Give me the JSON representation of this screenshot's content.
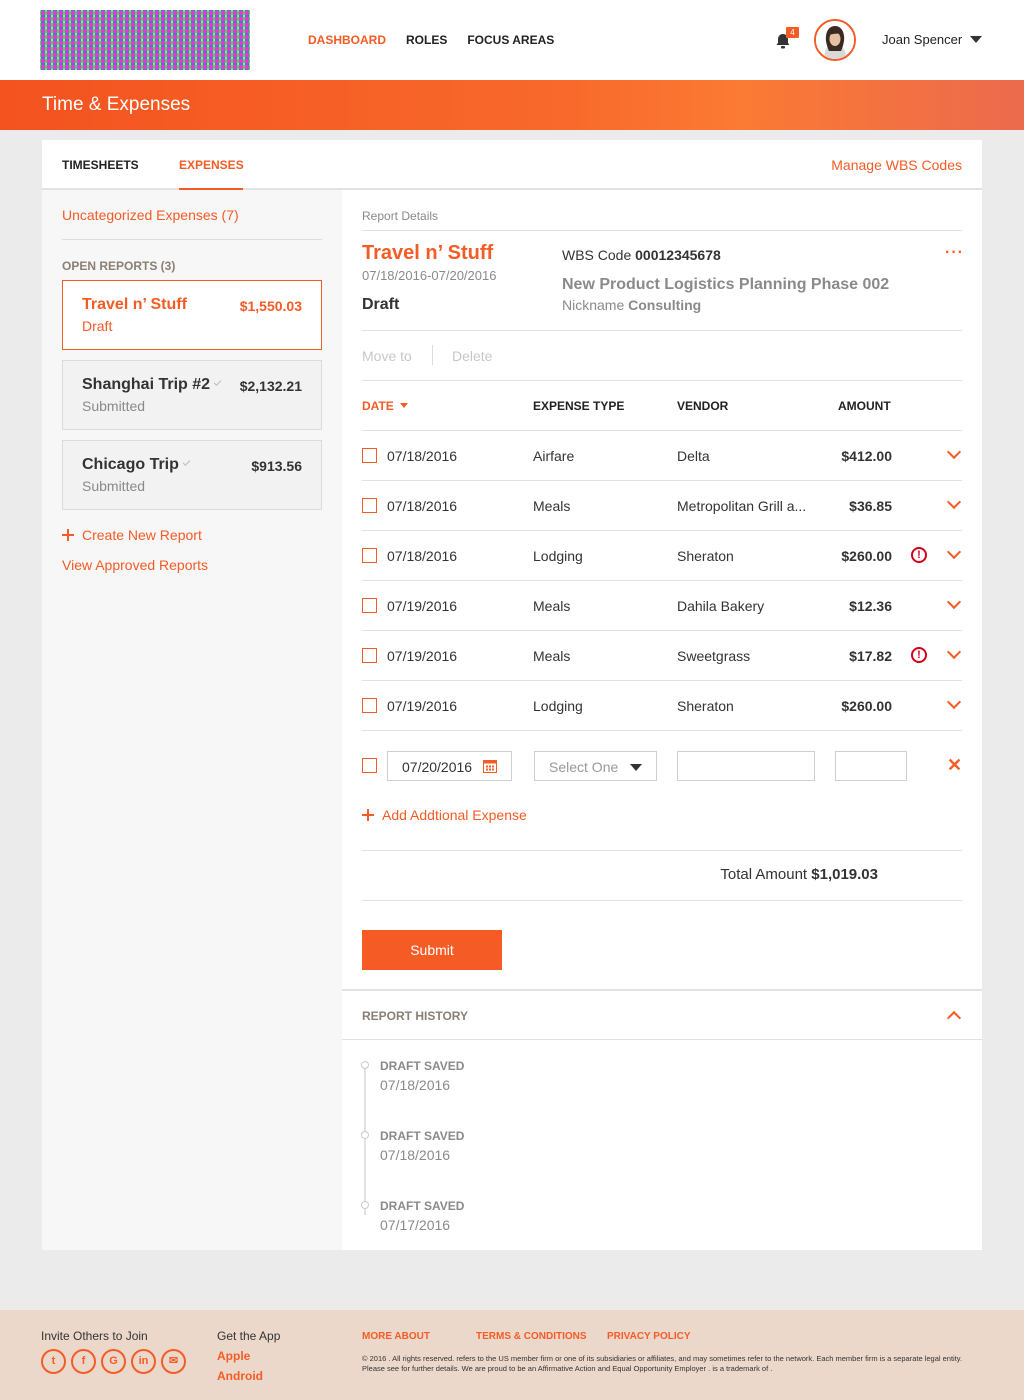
{
  "nav": {
    "items": [
      "DASHBOARD",
      "ROLES",
      "FOCUS AREAS"
    ],
    "active": 0
  },
  "user": {
    "notification_count": "4",
    "name": "Joan Spencer"
  },
  "banner": {
    "title": "Time & Expenses"
  },
  "tabs": {
    "timesheets": "TIMESHEETS",
    "expenses": "EXPENSES",
    "manage_link": "Manage WBS Codes"
  },
  "sidebar": {
    "uncategorized": "Uncategorized Expenses (7)",
    "open_reports_heading": "OPEN REPORTS (3)",
    "reports": [
      {
        "name": "Travel n’ Stuff",
        "amount": "$1,550.03",
        "status": "Draft"
      },
      {
        "name": "Shanghai Trip #2",
        "amount": "$2,132.21",
        "status": "Submitted"
      },
      {
        "name": "Chicago Trip",
        "amount": "$913.56",
        "status": "Submitted"
      }
    ],
    "create_report": "Create New Report",
    "view_approved": "View Approved Reports"
  },
  "report": {
    "section_label": "Report Details",
    "title": "Travel n’ Stuff",
    "date_range": "07/18/2016-07/20/2016",
    "status": "Draft",
    "wbs_label": "WBS Code",
    "wbs_code": "00012345678",
    "project": "New Product Logistics Planning Phase 002",
    "nickname_label": "Nickname",
    "nickname": "Consulting",
    "more": "···",
    "move_to": "Move to",
    "delete": "Delete"
  },
  "table": {
    "headers": {
      "date": "DATE",
      "type": "EXPENSE TYPE",
      "vendor": "VENDOR",
      "amount": "AMOUNT"
    },
    "rows": [
      {
        "date": "07/18/2016",
        "type": "Airfare",
        "vendor": "Delta",
        "amount": "$412.00",
        "warning": false
      },
      {
        "date": "07/18/2016",
        "type": "Meals",
        "vendor": "Metropolitan Grill a...",
        "amount": "$36.85",
        "warning": false
      },
      {
        "date": "07/18/2016",
        "type": "Lodging",
        "vendor": "Sheraton",
        "amount": "$260.00",
        "warning": true
      },
      {
        "date": "07/19/2016",
        "type": "Meals",
        "vendor": "Dahila Bakery",
        "amount": "$12.36",
        "warning": false
      },
      {
        "date": "07/19/2016",
        "type": "Meals",
        "vendor": "Sweetgrass",
        "amount": "$17.82",
        "warning": true
      },
      {
        "date": "07/19/2016",
        "type": "Lodging",
        "vendor": "Sheraton",
        "amount": "$260.00",
        "warning": false
      }
    ],
    "new_row": {
      "date": "07/20/2016",
      "type_placeholder": "Select One",
      "vendor": "",
      "amount": ""
    },
    "add_label": "Add Addtional Expense",
    "total_label": "Total Amount",
    "total": "$1,019.03",
    "submit": "Submit"
  },
  "history": {
    "title": "REPORT HISTORY",
    "events": [
      {
        "event": "DRAFT SAVED",
        "date": "07/18/2016"
      },
      {
        "event": "DRAFT SAVED",
        "date": "07/18/2016"
      },
      {
        "event": "DRAFT SAVED",
        "date": "07/17/2016"
      }
    ]
  },
  "footer": {
    "invite": "Invite Others to Join",
    "social": [
      "twitter-icon",
      "facebook-icon",
      "google-icon",
      "linkedin-icon",
      "mail-icon"
    ],
    "get_app": "Get the App",
    "apple": "Apple",
    "android": "Android",
    "more_about": "MORE ABOUT",
    "terms": "TERMS & CONDITIONS",
    "privacy": "PRIVACY POLICY",
    "legal": "© 2016        . All rights reserved.          refers to the US member firm or one of its subsidiaries or affiliates, and may sometimes refer to the          network. Each member firm is a separate legal entity. Please see                                    for further details. We are proud to be an Affirmative Action and Equal Opportunity Employer            . is a trademark of         ."
  },
  "colors": {
    "accent": "#f45b25",
    "warning": "#d0021b"
  }
}
